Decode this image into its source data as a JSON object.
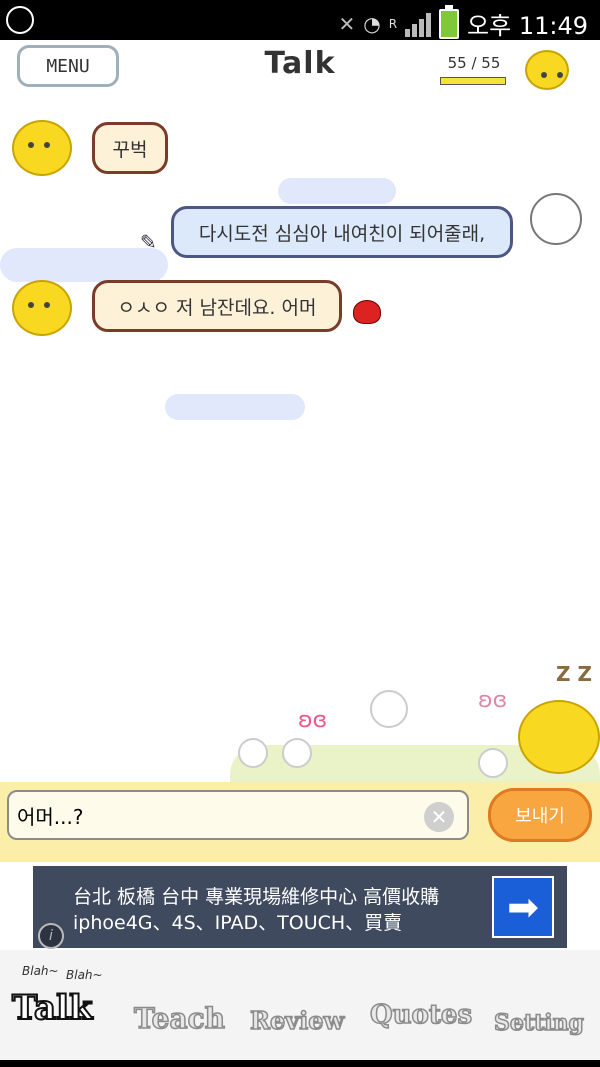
{
  "status": {
    "time": "오후 11:49",
    "network_badge": "R"
  },
  "header": {
    "menu_label": "MENU",
    "title": "Talk",
    "counter": "55 / 55",
    "counter_fill": 1.0
  },
  "messages": [
    {
      "from": "bot",
      "text": "꾸벅"
    },
    {
      "from": "user",
      "text": "다시도전 심심아 내여친이 되어줄래,"
    },
    {
      "from": "bot",
      "text": "ㅇㅅㅇ 저 남잔데요. 어머"
    }
  ],
  "composer": {
    "value": "어머...?",
    "send_label": "보내기"
  },
  "ad": {
    "line1": "台北 板橋 台中 專業現場維修中心 高價收購",
    "line2": "iphoe4G、4S、IPAD、TOUCH、買賣",
    "info": "i"
  },
  "tabs": {
    "talk": "Talk",
    "teach": "Teach",
    "review": "Review",
    "quotes": "Quotes",
    "setting": "Setting",
    "blah1": "Blah~",
    "blah2": "Blah~"
  },
  "decor": {
    "zz": "Z Z"
  },
  "colors": {
    "bot_bubble": "#fdf1d8",
    "user_bubble": "#dce9fb",
    "send_button": "#f7a640",
    "ad_bg": "#3f4a5e"
  }
}
